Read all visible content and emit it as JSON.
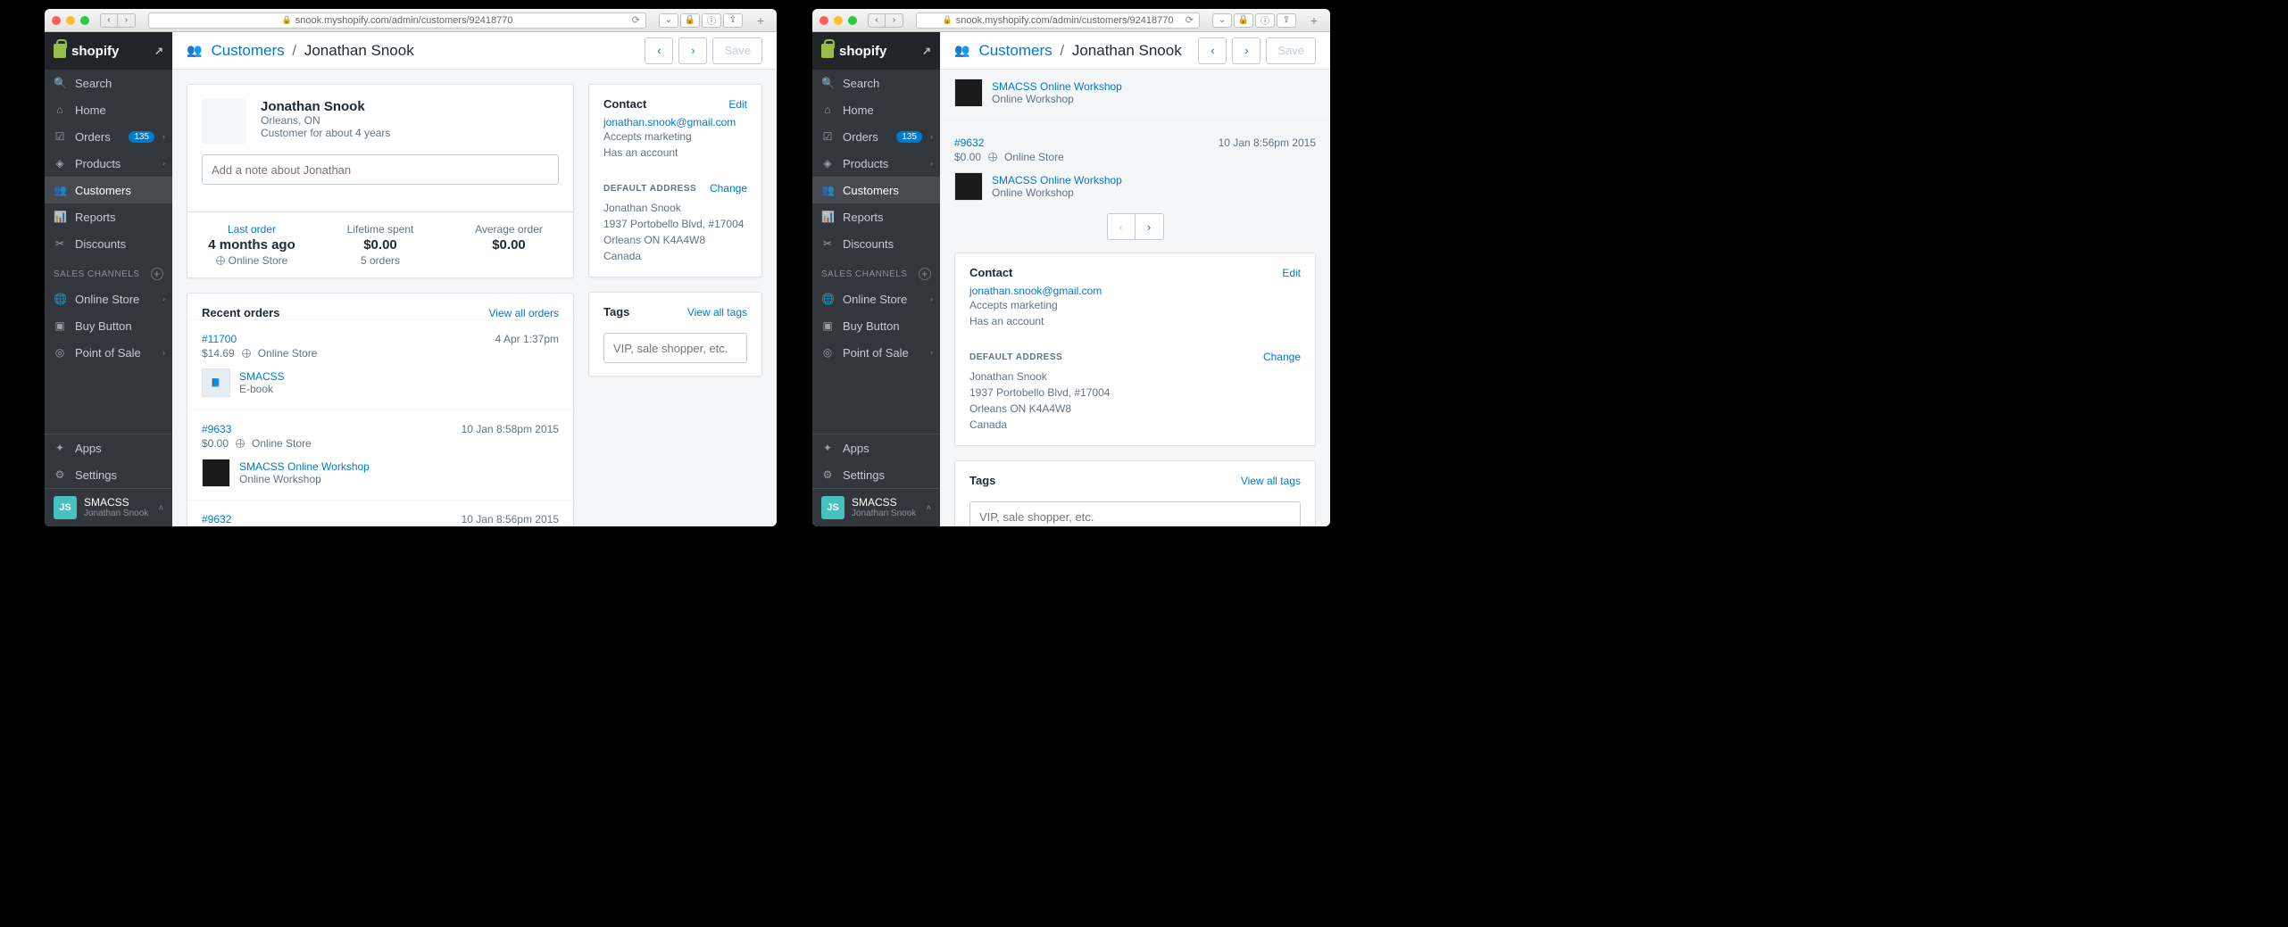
{
  "browser": {
    "url": "snook.myshopify.com/admin/customers/92418770"
  },
  "brand": "shopify",
  "sidebar": {
    "search": "Search",
    "home": "Home",
    "orders": "Orders",
    "orders_badge": "135",
    "products": "Products",
    "customers": "Customers",
    "reports": "Reports",
    "discounts": "Discounts",
    "channels_header": "SALES CHANNELS",
    "online_store": "Online Store",
    "buy_button": "Buy Button",
    "pos": "Point of Sale",
    "apps": "Apps",
    "settings": "Settings",
    "user_store": "SMACSS",
    "user_name": "Jonathan Snook"
  },
  "topbar": {
    "breadcrumb_link": "Customers",
    "breadcrumb_sep": "/",
    "breadcrumb_current": "Jonathan Snook",
    "save": "Save"
  },
  "customer": {
    "name": "Jonathan Snook",
    "location": "Orleans, ON",
    "since": "Customer for about 4 years",
    "note_placeholder": "Add a note about Jonathan",
    "stats": {
      "last_order_label": "Last order",
      "last_order_value": "4 months ago",
      "last_order_sub": "Online Store",
      "lifetime_label": "Lifetime spent",
      "lifetime_value": "$0.00",
      "lifetime_sub": "5 orders",
      "avg_label": "Average order",
      "avg_value": "$0.00"
    }
  },
  "recent_orders": {
    "title": "Recent orders",
    "view_all": "View all orders",
    "orders": [
      {
        "id": "#11700",
        "price": "$14.69",
        "channel": "Online Store",
        "date": "4 Apr 1:37pm",
        "item_name": "SMACSS",
        "item_sub": "E-book",
        "thumb": "blue"
      },
      {
        "id": "#9633",
        "price": "$0.00",
        "channel": "Online Store",
        "date": "10 Jan 8:58pm 2015",
        "item_name": "SMACSS Online Workshop",
        "item_sub": "Online Workshop",
        "thumb": "dark"
      },
      {
        "id": "#9632",
        "price": "$0.00",
        "channel": "Online Store",
        "date": "10 Jan 8:56pm 2015",
        "item_name": "SMACSS Online Workshop",
        "item_sub": "Online Workshop",
        "thumb": "dark"
      }
    ]
  },
  "contact": {
    "title": "Contact",
    "edit": "Edit",
    "email": "jonathan.snook@gmail.com",
    "line1": "Accepts marketing",
    "line2": "Has an account",
    "addr_title": "DEFAULT ADDRESS",
    "change": "Change",
    "addr": {
      "name": "Jonathan Snook",
      "street": "1937 Portobello Blvd, #17004",
      "city": "Orleans ON K4A4W8",
      "country": "Canada"
    }
  },
  "tags": {
    "title": "Tags",
    "view_all": "View all tags",
    "placeholder": "VIP, sale shopper, etc."
  }
}
